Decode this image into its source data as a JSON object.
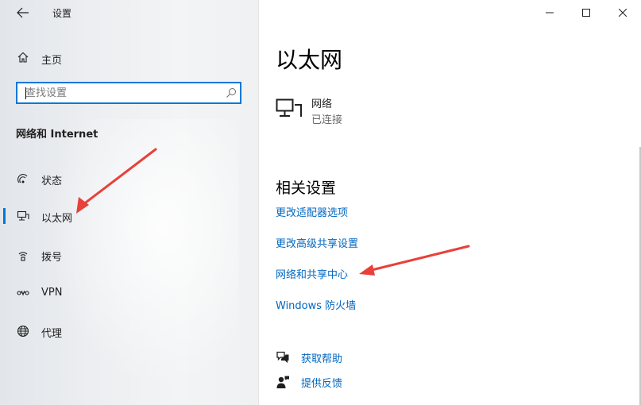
{
  "app": {
    "title": "设置"
  },
  "sidebar": {
    "home_label": "主页",
    "search": {
      "placeholder": "查找设置"
    },
    "section_heading": "网络和 Internet",
    "items": [
      {
        "label": "状态",
        "icon": "status-icon",
        "active": false
      },
      {
        "label": "以太网",
        "icon": "ethernet-icon",
        "active": true
      },
      {
        "label": "拨号",
        "icon": "dialup-icon",
        "active": false
      },
      {
        "label": "VPN",
        "icon": "vpn-icon",
        "active": false
      },
      {
        "label": "代理",
        "icon": "globe-icon",
        "active": false
      }
    ]
  },
  "main": {
    "title": "以太网",
    "network": {
      "name": "网络",
      "status": "已连接"
    },
    "related_heading": "相关设置",
    "links": [
      "更改适配器选项",
      "更改高级共享设置",
      "网络和共享中心",
      "Windows 防火墙"
    ],
    "help": {
      "get_help": "获取帮助",
      "feedback": "提供反馈"
    }
  },
  "colors": {
    "accent": "#0078d7",
    "link": "#0067c0",
    "annotation_arrow": "#e8403a"
  }
}
